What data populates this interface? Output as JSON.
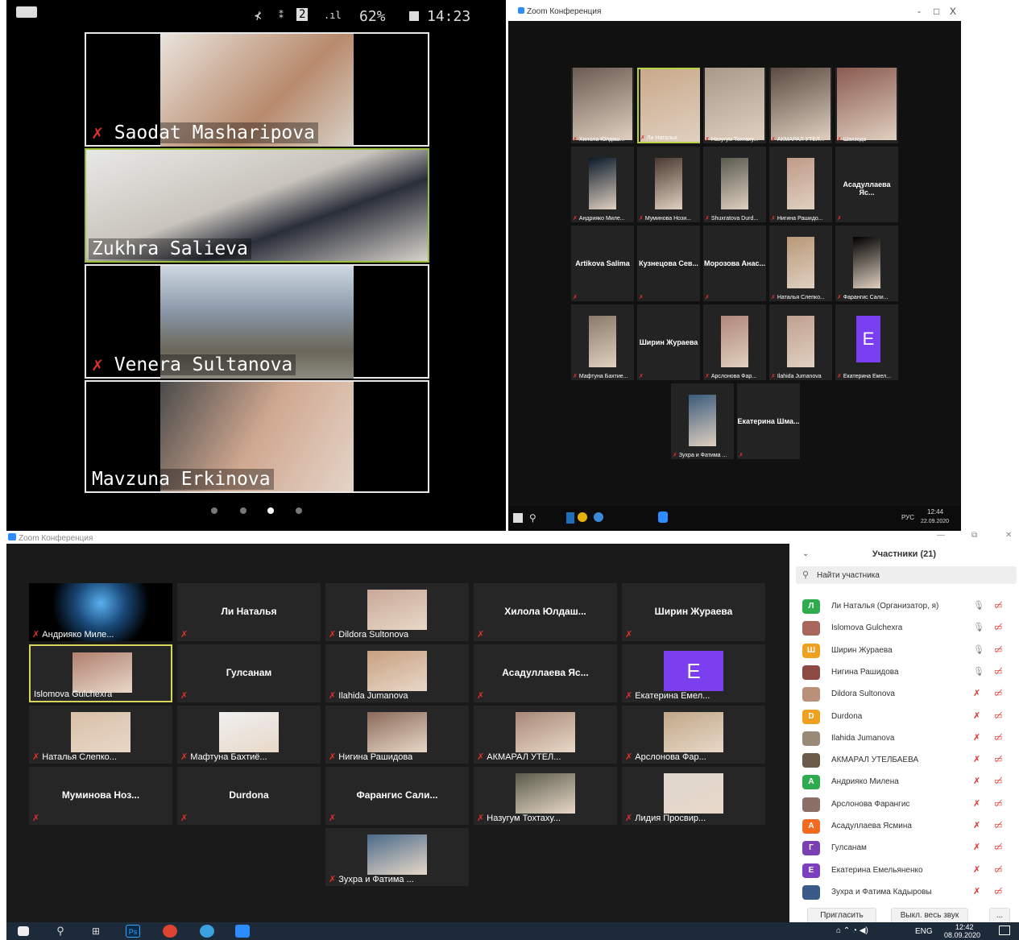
{
  "phone": {
    "status": {
      "battery": "62%",
      "time": "14:23",
      "sim": "2"
    },
    "tiles": [
      {
        "name": "Saodat Masharipova",
        "muted": true
      },
      {
        "name": "Zukhra Salieva",
        "muted": false,
        "active": true
      },
      {
        "name": "Venera Sultanova",
        "muted": true
      },
      {
        "name": "Mavzuna Erkinova",
        "muted": false
      }
    ],
    "page_dots": 4,
    "current_page": 3
  },
  "desktop": {
    "title": "Zoom Конференция",
    "controls": {
      "minimize": "-",
      "restore": "□",
      "close": "X"
    },
    "tiles": [
      {
        "label": "Хилола Юлдаш..."
      },
      {
        "label": "Ли Наталья"
      },
      {
        "label": "Назугум Тохтаху..."
      },
      {
        "label": "АКМАРАЛ УТЕЛ..."
      },
      {
        "label": "Шахзода"
      },
      {
        "label": "Андрияко Миле..."
      },
      {
        "label": "Муминова Нози..."
      },
      {
        "label": "Shuxratova Durd..."
      },
      {
        "label": "Нигина Рашидо..."
      },
      {
        "center": "Асадуллаева Яс..."
      },
      {
        "center": "Artikova Salima"
      },
      {
        "center": "Кузнецова Сев..."
      },
      {
        "center": "Морозова Анас..."
      },
      {
        "label": "Наталья Слепко..."
      },
      {
        "label": "Фарангис Сали..."
      },
      {
        "label": "Мафтуна Бахтие..."
      },
      {
        "center": "Ширин Жураева"
      },
      {
        "label": "Арслонова Фар..."
      },
      {
        "label": "Ilahida Jumanova"
      },
      {
        "label": "Екатерина Емел...",
        "letter": "E"
      },
      {
        "label": "Зухра и Фатима ..."
      },
      {
        "center": "Екатерина Шма..."
      }
    ],
    "taskbar": {
      "lang": "РУС",
      "time": "12:44",
      "date": "22.09.2020"
    }
  },
  "zoom": {
    "title": "Zoom Конференция",
    "tiles": [
      {
        "label": "Андрияко Миле..."
      },
      {
        "center": "Ли Наталья"
      },
      {
        "label": "Dildora Sultonova"
      },
      {
        "center": "Хилола Юлдаш..."
      },
      {
        "center": "Ширин Жураева"
      },
      {
        "label": "Islomova Gulchexra",
        "active": true
      },
      {
        "center": "Гулсанам"
      },
      {
        "label": "Ilahida Jumanova"
      },
      {
        "center": "Асадуллаева Яс..."
      },
      {
        "label": "Екатерина Емел...",
        "letter": "E"
      },
      {
        "label": "Наталья Слепко..."
      },
      {
        "label": "Мафтуна Бахтиё..."
      },
      {
        "label": "Нигина Рашидова"
      },
      {
        "label": "АКМАРАЛ УТЕЛ..."
      },
      {
        "label": "Арслонова Фар..."
      },
      {
        "center": "Муминова Ноз..."
      },
      {
        "center": "Durdona"
      },
      {
        "center": "Фарангис Сали..."
      },
      {
        "label": "Назугум Тохтаху..."
      },
      {
        "label": "Лидия Просвир..."
      },
      {
        "label": "Зухра и Фатима ..."
      }
    ],
    "panel": {
      "title": "Участники (21)",
      "search_placeholder": "Найти участника",
      "participants": [
        {
          "name": "Ли Наталья (Организатор, я)",
          "avatar": "Л",
          "color": "#2faa4e",
          "mic": "on"
        },
        {
          "name": "Islomova Gulchexra",
          "avatar": "",
          "color": "#a8665d",
          "mic": "on"
        },
        {
          "name": "Ширин Жураева",
          "avatar": "Ш",
          "color": "#f0a020",
          "mic": "on"
        },
        {
          "name": "Нигина Рашидова",
          "avatar": "",
          "color": "#8d4a44",
          "mic": "on"
        },
        {
          "name": "Dildora Sultonova",
          "avatar": "",
          "color": "#b9917a",
          "mic": "off"
        },
        {
          "name": "Durdona",
          "avatar": "D",
          "color": "#f0a020",
          "mic": "off"
        },
        {
          "name": "Ilahida Jumanova",
          "avatar": "",
          "color": "#9a8a7a",
          "mic": "off"
        },
        {
          "name": "АКМАРАЛ УТЕЛБАЕВА",
          "avatar": "",
          "color": "#6b5a4a",
          "mic": "off"
        },
        {
          "name": "Андрияко Милена",
          "avatar": "А",
          "color": "#2faa4e",
          "mic": "off"
        },
        {
          "name": "Арслонова Фарангис",
          "avatar": "",
          "color": "#8c6f66",
          "mic": "off"
        },
        {
          "name": "Асадуллаева Ясмина",
          "avatar": "А",
          "color": "#f06a20",
          "mic": "off"
        },
        {
          "name": "Гулсанам",
          "avatar": "Г",
          "color": "#7a3fb0",
          "mic": "off"
        },
        {
          "name": "Екатерина Емельяненко",
          "avatar": "Е",
          "color": "#7b3fc0",
          "mic": "off"
        },
        {
          "name": "Зухра и Фатима Кадыровы",
          "avatar": "",
          "color": "#3a5a8a",
          "mic": "off"
        }
      ],
      "invite": "Пригласить",
      "mute_all": "Выкл. весь звук",
      "more": "..."
    },
    "taskbar": {
      "lang": "ENG",
      "time": "12:42",
      "date": "08.09.2020"
    }
  }
}
